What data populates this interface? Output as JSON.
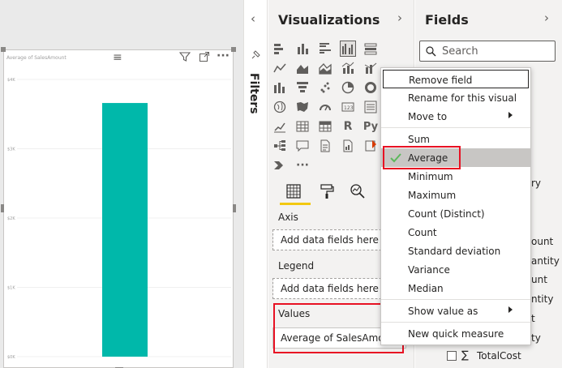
{
  "visualizations_pane": {
    "title": "Visualizations",
    "more_label": "···"
  },
  "fields_pane": {
    "title": "Fields",
    "search_placeholder": "Search"
  },
  "filters_label": "Filters",
  "chart": {
    "title": "Average of SalesAmount",
    "bar_color": "#00b8aa"
  },
  "chart_data": {
    "type": "bar",
    "title": "Average of SalesAmount",
    "y_ticks": [
      "$4K",
      "$3K",
      "$2K",
      "$1K",
      "$0K"
    ],
    "ylim": [
      0,
      4000
    ],
    "values": [
      3660
    ],
    "xlabel": "",
    "ylabel": ""
  },
  "format_tabs": [
    "fields-tab",
    "format-tab",
    "analytics-tab"
  ],
  "wells": [
    {
      "label": "Axis",
      "placeholder": "Add data fields here"
    },
    {
      "label": "Legend",
      "placeholder": "Add data fields here"
    },
    {
      "label": "Values",
      "value": "Average of SalesAmount"
    }
  ],
  "context_menu": {
    "items": [
      {
        "label": "Remove field"
      },
      {
        "label": "Rename for this visual"
      },
      {
        "label": "Move to"
      },
      {
        "label": "Sum"
      },
      {
        "label": "Average"
      },
      {
        "label": "Minimum"
      },
      {
        "label": "Maximum"
      },
      {
        "label": "Count (Distinct)"
      },
      {
        "label": "Count"
      },
      {
        "label": "Standard deviation"
      },
      {
        "label": "Variance"
      },
      {
        "label": "Median"
      },
      {
        "label": "Show value as"
      },
      {
        "label": "New quick measure"
      }
    ],
    "selected": "Average",
    "check_color": "#5cb85c"
  },
  "fields_fragments": [
    "ry",
    "ount",
    "antity",
    "unt",
    "ntity",
    "t",
    "ty"
  ],
  "fields_last": {
    "sigma": "∑",
    "label": "TotalCost"
  },
  "colors": {
    "highlight_red": "#e81123",
    "accent_yellow": "#f2c811"
  }
}
